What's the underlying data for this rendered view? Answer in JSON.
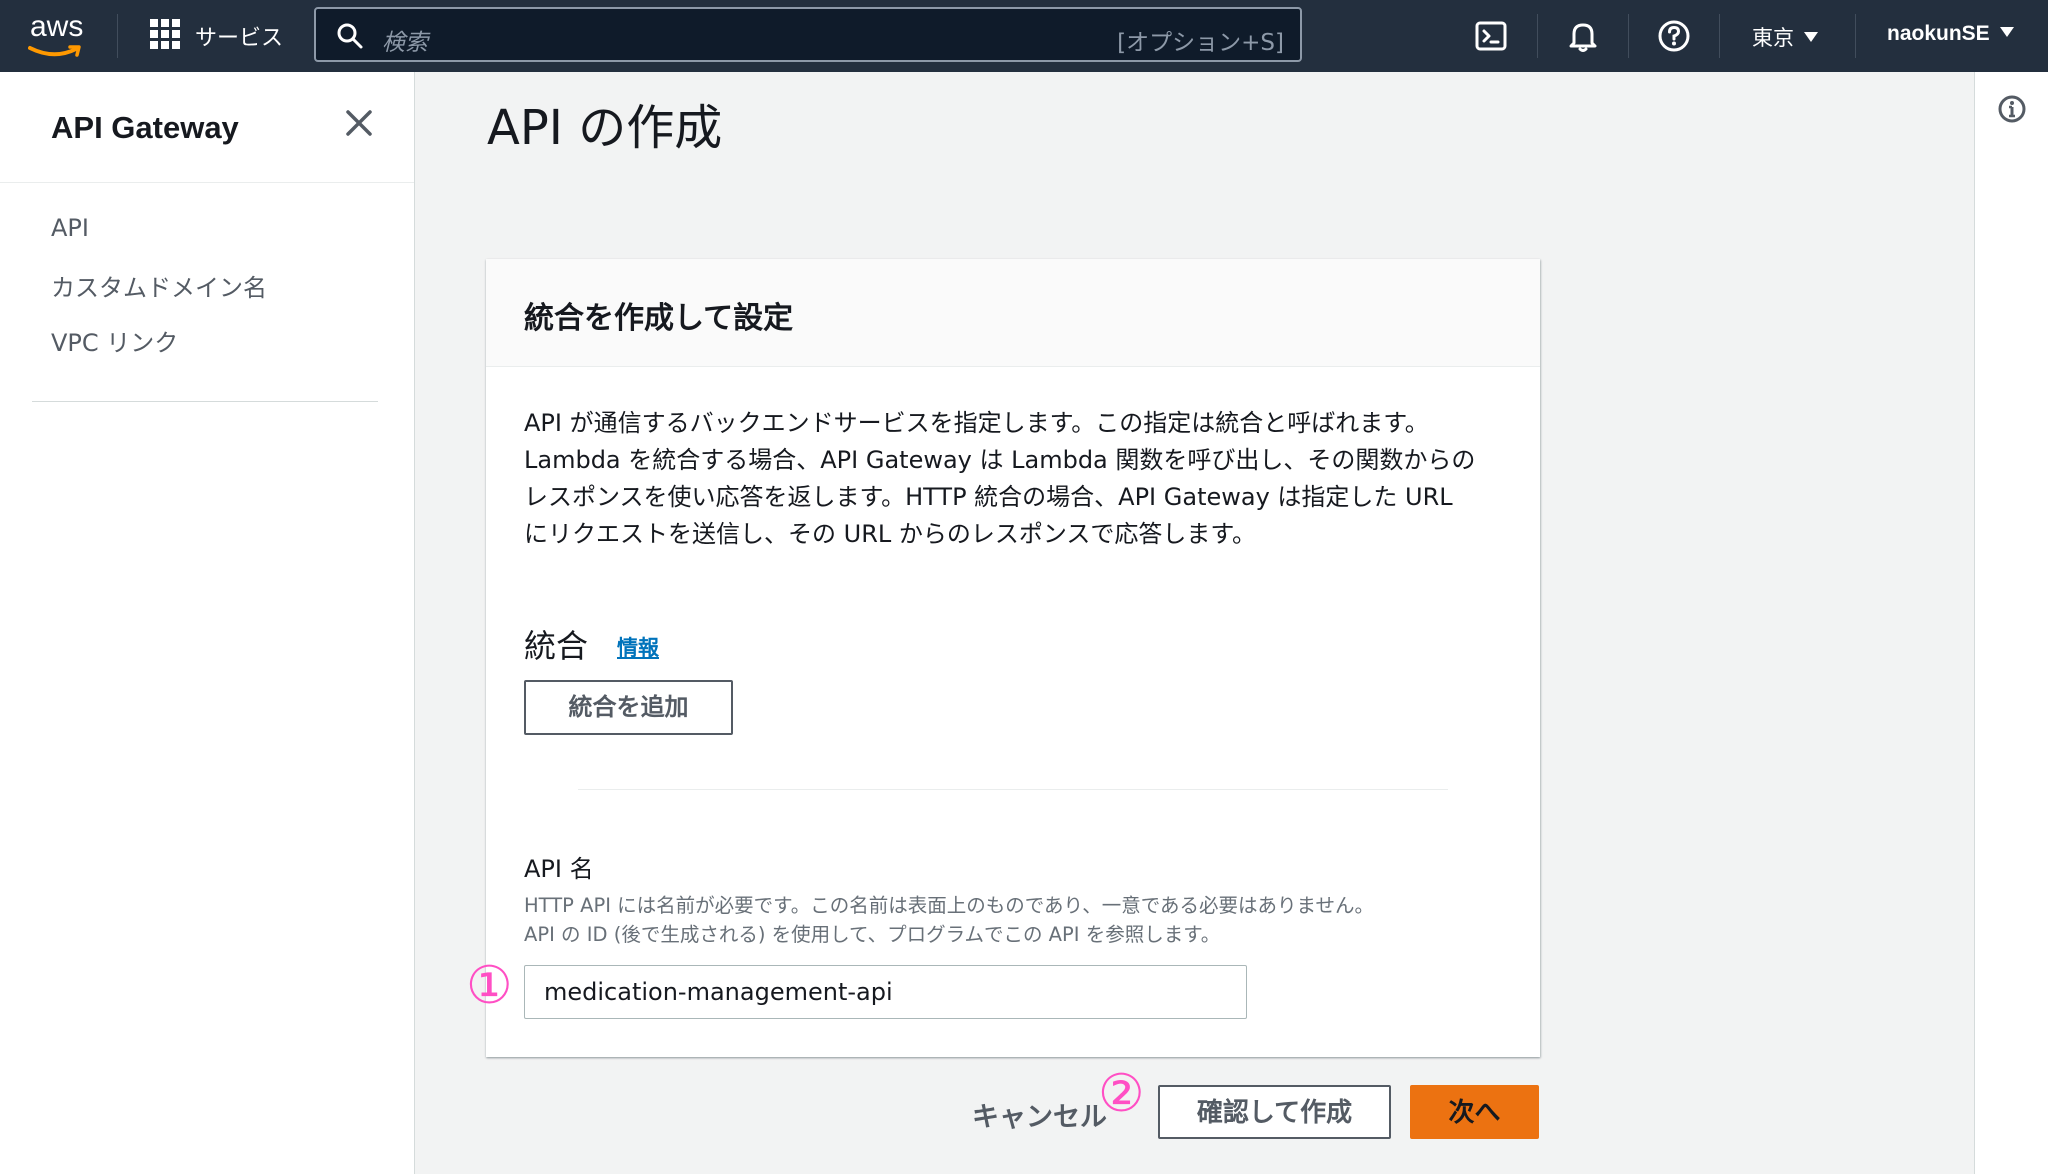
{
  "topnav": {
    "logo_text": "aws",
    "services_label": "サービス",
    "search": {
      "placeholder": "検索",
      "shortcut": "[オプション+S]"
    },
    "icons": [
      "cloudshell-icon",
      "bell-icon",
      "help-icon"
    ],
    "region": "東京",
    "user": "naokunSE"
  },
  "sidebar": {
    "title": "API Gateway",
    "items": [
      {
        "label": "API"
      },
      {
        "label": "カスタムドメイン名"
      },
      {
        "label": "VPC リンク"
      }
    ]
  },
  "page": {
    "title": "API の作成"
  },
  "card": {
    "title": "統合を作成して設定",
    "description": [
      "API が通信するバックエンドサービスを指定します。この指定は統合と呼ばれます。",
      "Lambda を統合する場合、API Gateway は Lambda 関数を呼び出し、その関数からの",
      "レスポンスを使い応答を返します。HTTP 統合の場合、API Gateway は指定した URL",
      "にリクエストを送信し、その URL からのレスポンスで応答します。"
    ],
    "integrations": {
      "label": "統合",
      "info_link": "情報",
      "add_button": "統合を追加"
    },
    "api_name": {
      "label": "API 名",
      "help": [
        "HTTP API には名前が必要です。この名前は表面上のものであり、一意である必要はありません。",
        "API の ID (後で生成される) を使用して、プログラムでこの API を参照します。"
      ],
      "value": "medication-management-api"
    }
  },
  "actions": {
    "cancel": "キャンセル",
    "review_create": "確認して作成",
    "next": "次へ"
  },
  "annotations": {
    "marker_1": "①",
    "marker_2": "②"
  },
  "colors": {
    "nav_bg": "#232f3e",
    "primary_button": "#ec7211",
    "link": "#0073bb",
    "annotation": "#ff4fc4"
  }
}
